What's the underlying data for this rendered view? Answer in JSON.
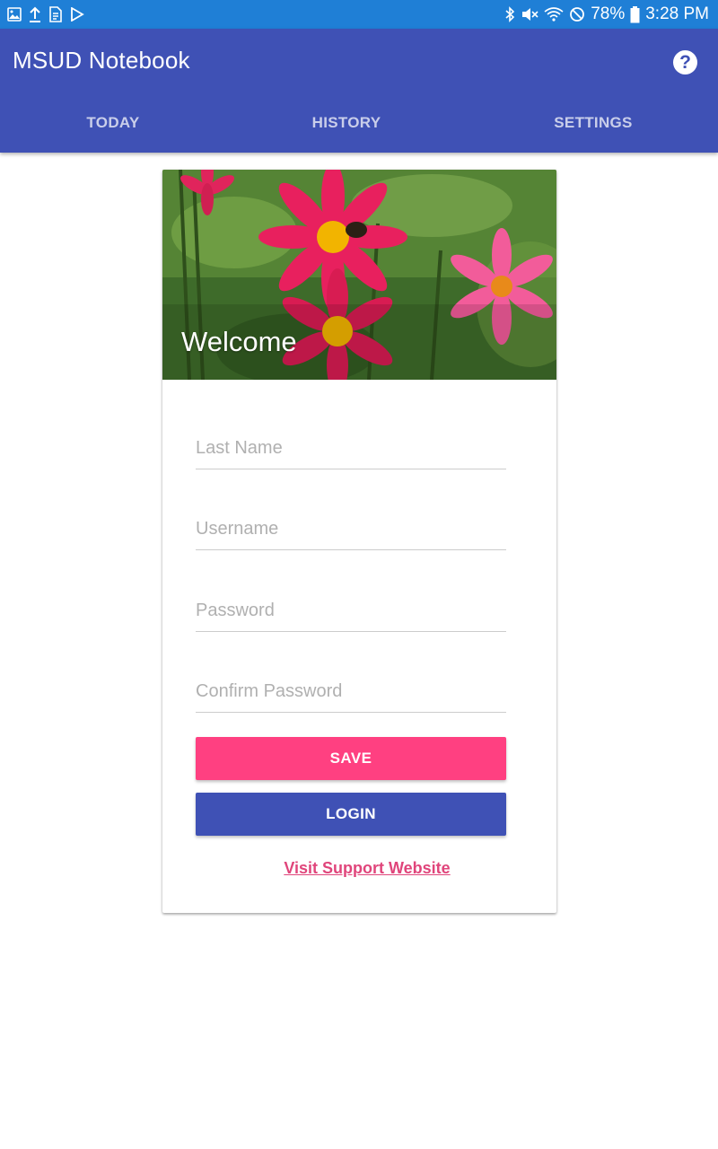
{
  "status_bar": {
    "battery": "78%",
    "time": "3:28 PM",
    "left_icons": [
      "gallery-icon",
      "upload-icon",
      "sim-card-icon",
      "play-store-icon"
    ],
    "right_icons": [
      "bluetooth-icon",
      "mute-icon",
      "wifi-icon",
      "do-not-disturb-icon",
      "battery-icon"
    ]
  },
  "app_bar": {
    "title": "MSUD Notebook",
    "help_icon": "?",
    "tabs": [
      {
        "label": "TODAY"
      },
      {
        "label": "HISTORY"
      },
      {
        "label": "SETTINGS"
      }
    ]
  },
  "card": {
    "welcome": "Welcome",
    "fields": [
      {
        "placeholder": "Last Name",
        "value": ""
      },
      {
        "placeholder": "Username",
        "value": ""
      },
      {
        "placeholder": "Password",
        "value": ""
      },
      {
        "placeholder": "Confirm Password",
        "value": ""
      }
    ],
    "save_label": "SAVE",
    "login_label": "LOGIN",
    "support_link": "Visit Support Website"
  },
  "colors": {
    "status_bar": "#1f7fd6",
    "primary": "#3f51b5",
    "accent": "#ff4081",
    "link": "#e0457b"
  }
}
